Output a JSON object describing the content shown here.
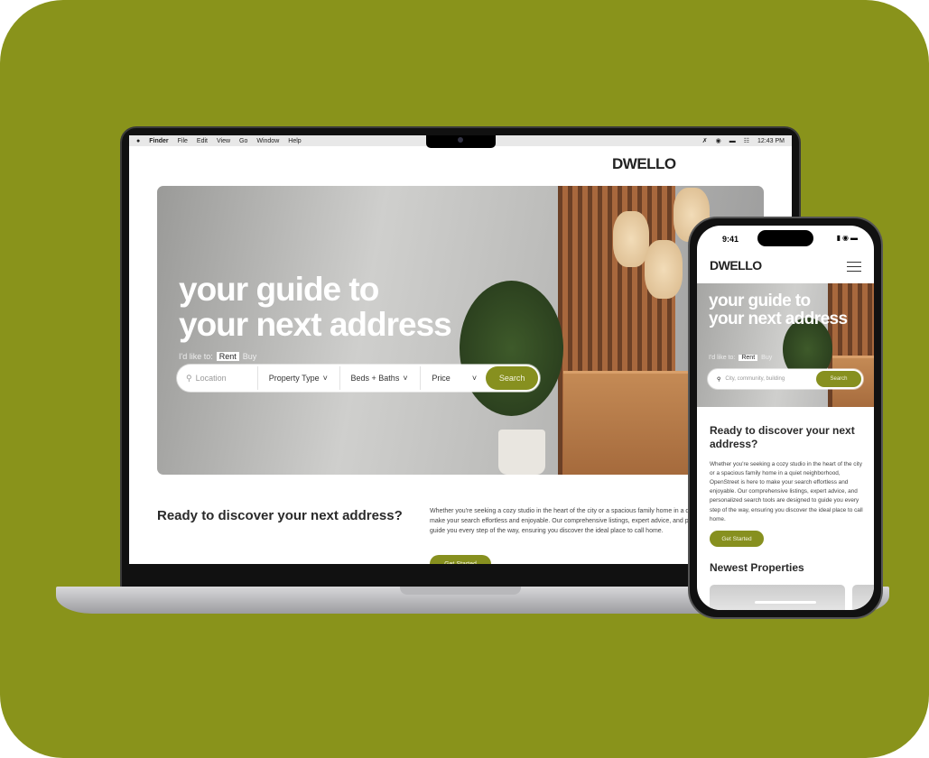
{
  "menubar": {
    "app": "Finder",
    "items": [
      "File",
      "Edit",
      "View",
      "Go",
      "Window",
      "Help"
    ],
    "clock": "12:43 PM",
    "icons": [
      "apple-icon",
      "mute-icon",
      "user-icon",
      "battery-icon",
      "control-center-icon"
    ]
  },
  "brand": "DWELLO",
  "hero": {
    "line1": "your guide to",
    "line2": "your next address",
    "like_label": "I'd like to:",
    "mode_active": "Rent",
    "mode_other": "Buy"
  },
  "search": {
    "location_placeholder": "Location",
    "property_type": "Property Type",
    "beds_baths": "Beds + Baths",
    "price": "Price",
    "button": "Search",
    "mobile_placeholder": "City, community, building"
  },
  "intro": {
    "title": "Ready to discover your next address?",
    "body": "Whether you're seeking a cozy studio in the heart of the city or a spacious family home in a quiet neighborhood, OpenStreet is here to make your search effortless and enjoyable. Our comprehensive listings, expert advice, and personalized search tools are designed to guide you every step of the way, ensuring you discover the ideal place to call home.",
    "cta": "Get Started"
  },
  "phone": {
    "time": "9:41",
    "newest_title": "Newest Properties"
  },
  "colors": {
    "background": "#89931b",
    "accent": "#87901f"
  }
}
